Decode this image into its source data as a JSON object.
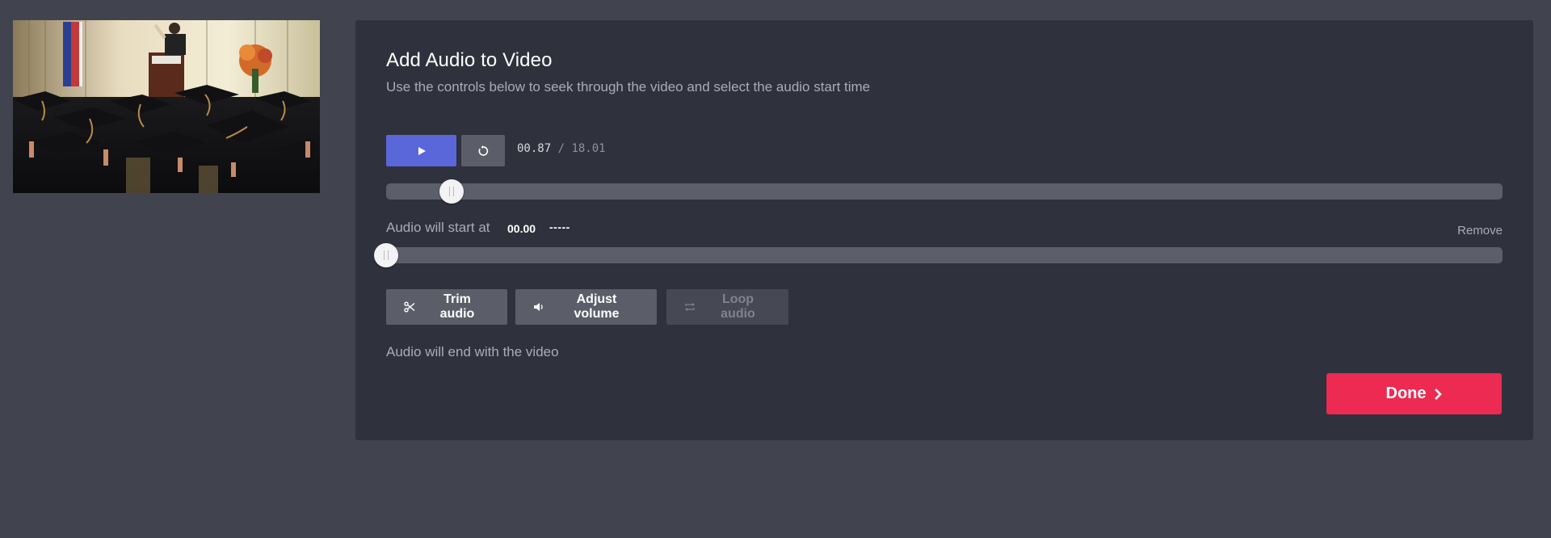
{
  "panel": {
    "title": "Add Audio to Video",
    "subtitle": "Use the controls below to seek through the video and select the audio start time"
  },
  "player": {
    "current_time": "00.87",
    "separator": " / ",
    "duration": "18.01",
    "play_icon": "play-icon",
    "restart_icon": "restart-icon",
    "video_progress": 0.048
  },
  "audio": {
    "start_label": "Audio will start at",
    "start_value": "00.00",
    "start_dash": "-----",
    "remove_label": "Remove",
    "audio_start_position": 0.0,
    "end_note": "Audio will end with the video"
  },
  "tools": {
    "trim_label": "Trim audio",
    "trim_icon": "scissors-icon",
    "volume_label": "Adjust volume",
    "volume_icon": "speaker-icon",
    "loop_label": "Loop audio",
    "loop_icon": "loop-icon"
  },
  "done": {
    "label": "Done",
    "icon": "chevron-right-icon"
  },
  "colors": {
    "background": "#41444f",
    "panel": "#2f323c",
    "play_button": "#5a67d8",
    "done_button": "#ec2a52",
    "track": "#5c5f6a"
  }
}
